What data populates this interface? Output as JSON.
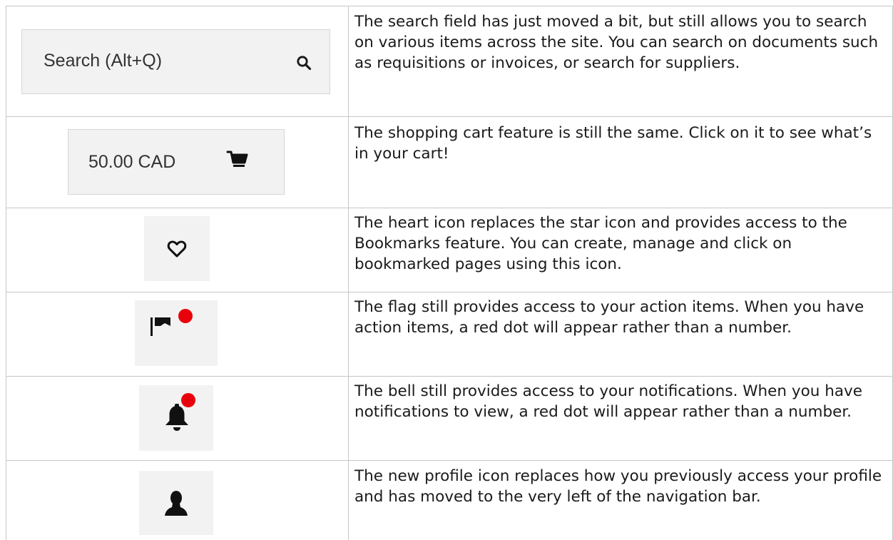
{
  "rows": [
    {
      "ui": {
        "label": "Search (Alt+Q)",
        "icon": "search-icon"
      },
      "description": "The search field has just moved a bit, but still allows you to search on various items across the site. You can search on documents such as requisitions or invoices, or search for suppliers."
    },
    {
      "ui": {
        "label": "50.00 CAD",
        "icon": "cart-icon"
      },
      "description": "The shopping cart feature is still the same.  Click on it to see what’s in your cart!"
    },
    {
      "ui": {
        "icon": "heart-icon"
      },
      "description": "The heart icon replaces the star icon and provides access to the Bookmarks feature. You can create, manage and click on bookmarked pages using this icon."
    },
    {
      "ui": {
        "icon": "flag-icon",
        "badge": "red-dot"
      },
      "description": "The flag still provides access to your action items. When you have action items, a red dot will appear rather than a number."
    },
    {
      "ui": {
        "icon": "bell-icon",
        "badge": "red-dot"
      },
      "description": "The bell still provides access to your notifications. When you have notifications to view, a red dot will appear rather than a number."
    },
    {
      "ui": {
        "icon": "profile-icon"
      },
      "description": "The new profile icon replaces how you previously access your profile and has moved to the very left of the navigation bar."
    }
  ],
  "colors": {
    "badge": "#e8000b",
    "icon": "#111111",
    "ui_background": "#f2f2f2",
    "border": "#c6c6c6"
  }
}
